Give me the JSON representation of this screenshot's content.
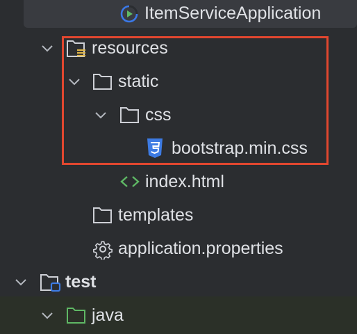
{
  "project_tree": {
    "items": [
      {
        "label": "ItemServiceApplication",
        "icon": "spring-boot-run-icon",
        "expanded": null,
        "selected": true
      },
      {
        "label": "resources",
        "icon": "resources-folder-icon",
        "expanded": true
      },
      {
        "label": "static",
        "icon": "folder-icon",
        "expanded": true
      },
      {
        "label": "css",
        "icon": "folder-icon",
        "expanded": true
      },
      {
        "label": "bootstrap.min.css",
        "icon": "css-file-icon"
      },
      {
        "label": "index.html",
        "icon": "html-file-icon"
      },
      {
        "label": "templates",
        "icon": "folder-icon",
        "expanded": false
      },
      {
        "label": "application.properties",
        "icon": "gear-icon"
      },
      {
        "label": "test",
        "icon": "test-module-icon",
        "expanded": true
      },
      {
        "label": "java",
        "icon": "test-source-folder-icon",
        "expanded": true
      }
    ]
  },
  "colors": {
    "background": "#2b2d30",
    "selection": "#393b40",
    "highlight_border": "#e2472f",
    "text": "#dfe1e5",
    "css_badge": "#3d7be3",
    "html_icon": "#5fb865",
    "test_icon": "#3d7be3",
    "test_source": "#5fb865",
    "spring_icon": "#3b78e7"
  }
}
